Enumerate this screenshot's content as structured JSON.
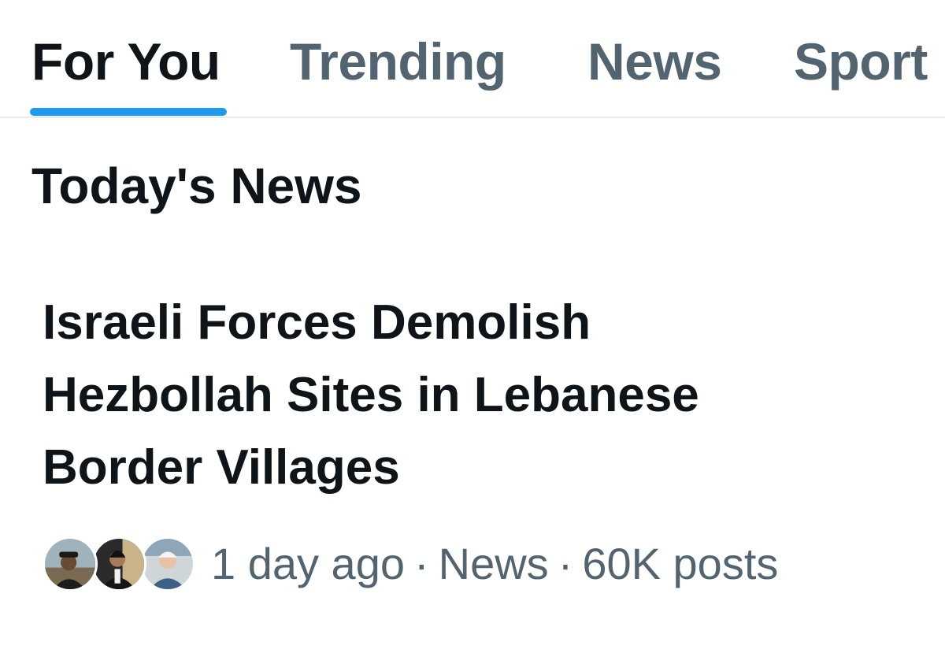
{
  "tabs": [
    {
      "label": "For You",
      "active": true
    },
    {
      "label": "Trending",
      "active": false
    },
    {
      "label": "News",
      "active": false
    },
    {
      "label": "Sport",
      "active": false
    }
  ],
  "accent_color": "#1d9bf0",
  "section": {
    "title": "Today's News"
  },
  "story": {
    "headline_lines": [
      "Israeli Forces Demolish",
      "Hezbollah Sites in Lebanese",
      "Border Villages"
    ],
    "avatars": [
      "avatar-person-hat",
      "avatar-person-dark-suit",
      "avatar-person-white-hair"
    ],
    "time": "1 day ago",
    "separator": "·",
    "category": "News",
    "posts": "60K posts"
  }
}
